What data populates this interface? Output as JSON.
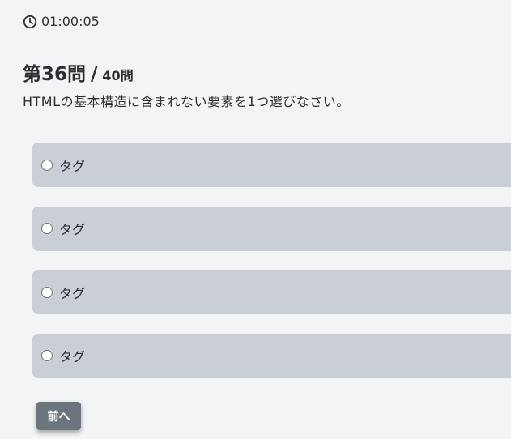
{
  "timer": {
    "icon": "clock-icon",
    "value": "01:00:05"
  },
  "question": {
    "number_label": "第36問",
    "separator": "/",
    "total_label": "40問",
    "text": "HTMLの基本構造に含まれない要素を1つ選びなさい。"
  },
  "options": [
    {
      "label": "タグ",
      "selected": false
    },
    {
      "label": "タグ",
      "selected": false
    },
    {
      "label": "タグ",
      "selected": false
    },
    {
      "label": "タグ",
      "selected": false
    }
  ],
  "nav": {
    "prev_label": "前へ"
  },
  "colors": {
    "background": "#f3f4f6",
    "option_bg": "#c9ced7",
    "button_bg": "#6c757d",
    "text": "#2b2f33"
  }
}
